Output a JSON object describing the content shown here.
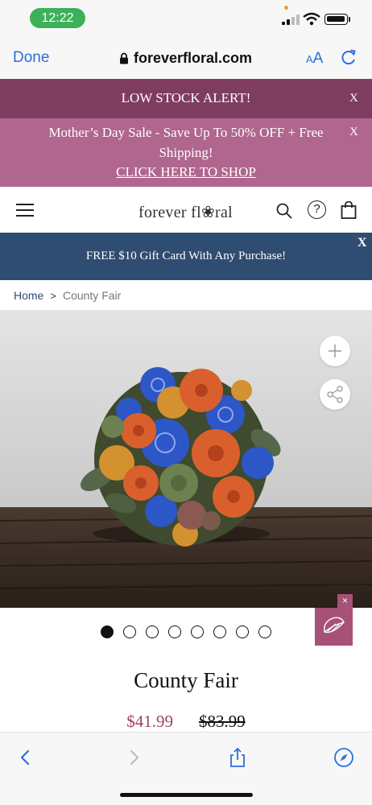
{
  "status_bar": {
    "time": "12:22"
  },
  "browser": {
    "done_label": "Done",
    "url": "foreverfloral.com",
    "text_size_label": "AA"
  },
  "alerts": {
    "low_stock": "LOW STOCK ALERT!",
    "close_symbol": "X",
    "sale_line1": "Mother’s Day Sale - Save Up To 50% OFF + Free",
    "sale_line2": "Shipping!",
    "sale_link": "CLICK HERE TO SHOP"
  },
  "header": {
    "logo": "forever fl❀ral"
  },
  "promo": {
    "gift_card": "FREE $10 Gift Card With Any Purchase!",
    "close_symbol": "X"
  },
  "breadcrumb": {
    "home": "Home",
    "separator": ">",
    "current": "County Fair"
  },
  "gallery": {
    "slide_count": 8,
    "active_slide": 1
  },
  "chat": {
    "close_symbol": "×"
  },
  "product": {
    "title": "County Fair",
    "sale_price": "$41.99",
    "original_price": "$83.99"
  },
  "icons": [
    "lock-icon",
    "reload-icon",
    "hamburger-icon",
    "search-icon",
    "help-icon",
    "bag-icon",
    "plus-icon",
    "share-icon",
    "chat-icon",
    "back-icon",
    "forward-icon",
    "share-sheet-icon",
    "compass-icon"
  ],
  "colors": {
    "low_stock_bg": "#7e3d5e",
    "sale_bg": "#b0668e",
    "gift_bg": "#2f4c71",
    "accent_link": "#2b6fdb",
    "price_sale": "#a0436c"
  }
}
